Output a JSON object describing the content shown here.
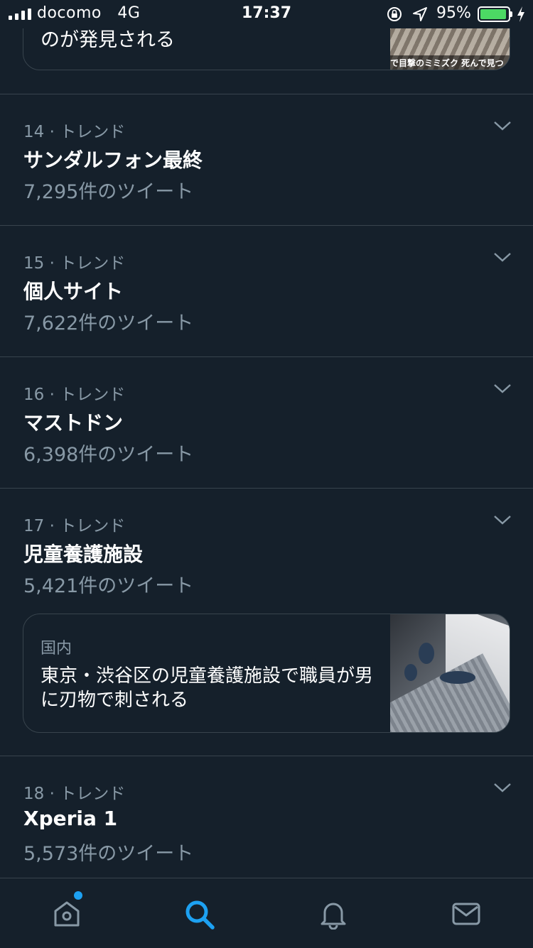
{
  "status_bar": {
    "carrier": "docomo",
    "network": "4G",
    "time": "17:37",
    "battery_percent": "95%",
    "battery_level": 0.95,
    "battery_color": "#4cd964"
  },
  "top_card": {
    "text": "のが発見される",
    "image_caption": "で目撃のミミズク 死んで見つ"
  },
  "trends": [
    {
      "meta": "14 · トレンド",
      "name": "サンダルフォン最終",
      "count": "7,295件のツイート"
    },
    {
      "meta": "15 · トレンド",
      "name": "個人サイト",
      "count": "7,622件のツイート"
    },
    {
      "meta": "16 · トレンド",
      "name": "マストドン",
      "count": "6,398件のツイート"
    },
    {
      "meta": "17 · トレンド",
      "name": "児童養護施設",
      "count": "5,421件のツイート"
    },
    {
      "meta": "18 · トレンド",
      "name": "Xperia 1",
      "count": "5,573件のツイート"
    }
  ],
  "news_card": {
    "category": "国内",
    "headline": "東京・渋谷区の児童養護施設で職員が男に刃物で刺される"
  },
  "tab_bar": {
    "items": [
      {
        "icon": "home-icon",
        "active": false,
        "has_notification": true
      },
      {
        "icon": "search-icon",
        "active": true
      },
      {
        "icon": "bell-icon",
        "active": false
      },
      {
        "icon": "mail-icon",
        "active": false
      }
    ]
  },
  "colors": {
    "background": "#15202b",
    "divider": "#38444d",
    "secondary_text": "#8899a6",
    "accent": "#1da1f2"
  }
}
